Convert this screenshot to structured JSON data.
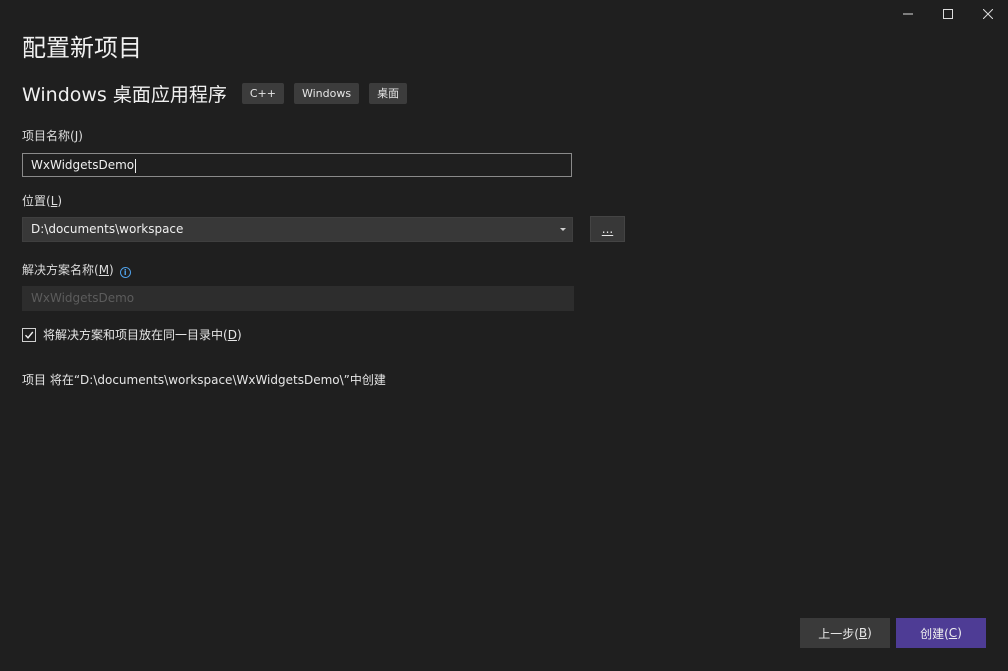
{
  "window": {
    "title": "配置新项目",
    "controls": {
      "minimize_icon": "minimize-icon",
      "maximize_icon": "maximize-icon",
      "close_icon": "close-icon"
    }
  },
  "template": {
    "name": "Windows 桌面应用程序",
    "tags": [
      "C++",
      "Windows",
      "桌面"
    ]
  },
  "project_name": {
    "label_pre": "项目名称(",
    "label_key": "J",
    "label_post": ")",
    "value": "WxWidgetsDemo"
  },
  "location": {
    "label_pre": "位置(",
    "label_key": "L",
    "label_post": ")",
    "value": "D:\\documents\\workspace",
    "browse_label": "..."
  },
  "solution_name": {
    "label_pre": "解决方案名称(",
    "label_key": "M",
    "label_post": ")",
    "value": "WxWidgetsDemo",
    "info_icon": "info-icon"
  },
  "same_dir_option": {
    "label_pre": "将解决方案和项目放在同一目录中(",
    "label_key": "D",
    "label_post": ")",
    "checked": true
  },
  "summary": "项目 将在“D:\\documents\\workspace\\WxWidgetsDemo\\”中创建",
  "footer": {
    "back_pre": "上一步(",
    "back_key": "B",
    "back_post": ")",
    "create_pre": "创建(",
    "create_key": "C",
    "create_post": ")"
  },
  "colors": {
    "background": "#1f1f1f",
    "primary_button": "#4e3c95",
    "secondary_button": "#3a3a3a",
    "info_accent": "#4fa0e8"
  }
}
